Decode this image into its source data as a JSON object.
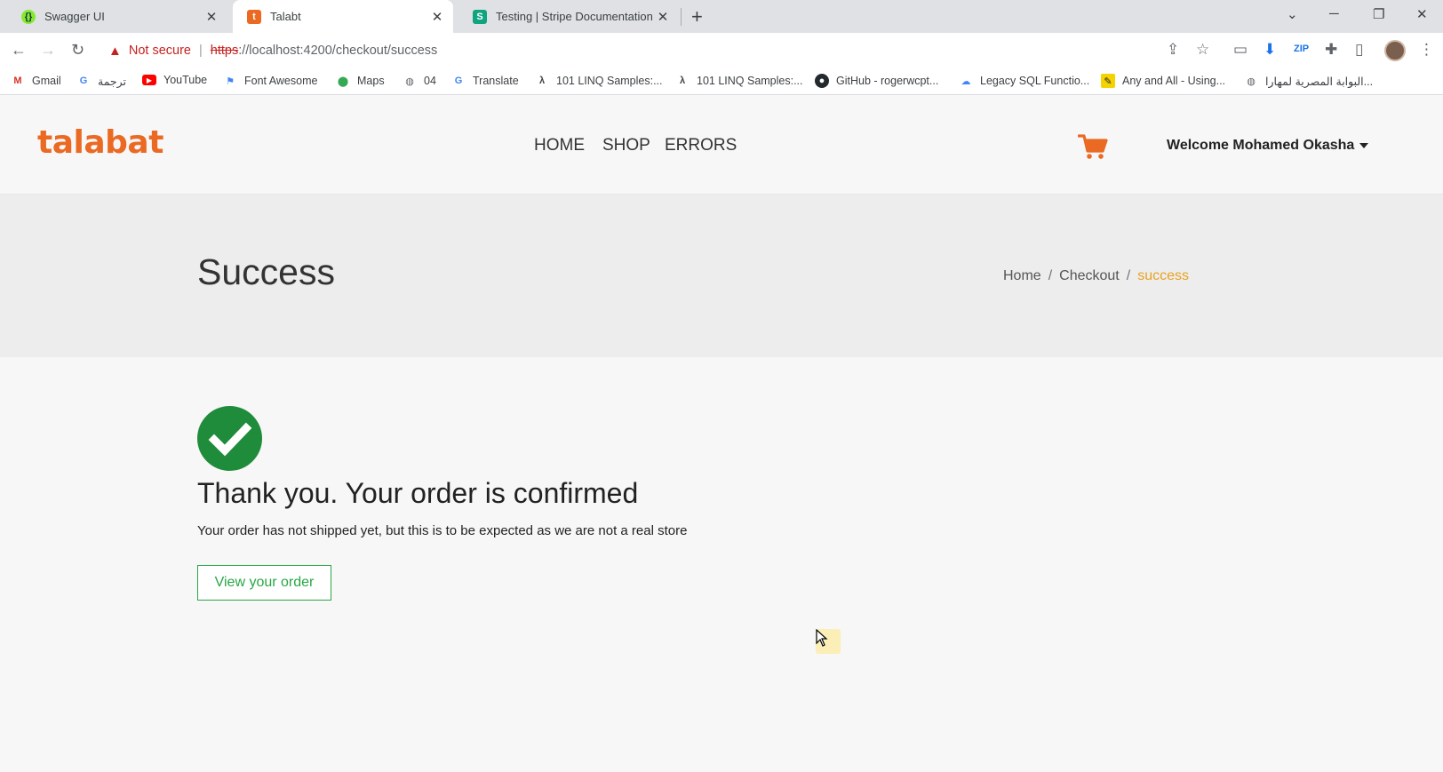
{
  "browser": {
    "tabs": [
      {
        "title": "Swagger UI",
        "favicon": "swagger-icon",
        "favicon_color": "#85ea2d",
        "active": false
      },
      {
        "title": "Talabt",
        "favicon": "talabat-icon",
        "favicon_color": "#ea6a24",
        "active": true
      },
      {
        "title": "Testing | Stripe Documentation",
        "favicon": "stripe-icon",
        "favicon_color": "#10a37f",
        "active": false
      }
    ],
    "address": {
      "warning": "Not secure",
      "scheme": "https",
      "rest": "://localhost:4200/checkout/success"
    },
    "bookmarks": [
      {
        "label": "Gmail",
        "icon": "gmail-icon"
      },
      {
        "label": "ترجمة",
        "icon": "translate-icon"
      },
      {
        "label": "YouTube",
        "icon": "youtube-icon"
      },
      {
        "label": "Font Awesome",
        "icon": "flag-icon"
      },
      {
        "label": "Maps",
        "icon": "maps-icon"
      },
      {
        "label": "04",
        "icon": "globe-icon"
      },
      {
        "label": "Translate",
        "icon": "translate-icon"
      },
      {
        "label": "101 LINQ Samples:...",
        "icon": "linq-icon"
      },
      {
        "label": "101 LINQ Samples:...",
        "icon": "linq-icon"
      },
      {
        "label": "GitHub - rogerwcpt...",
        "icon": "github-icon"
      },
      {
        "label": "Legacy SQL Functio...",
        "icon": "cloud-icon"
      },
      {
        "label": "Any and All - Using...",
        "icon": "pencil-icon"
      },
      {
        "label": "البوابة المصرية لمهارا...",
        "icon": "globe-icon"
      }
    ]
  },
  "site": {
    "logo": "talabat",
    "nav": [
      "HOME",
      "SHOP",
      "ERRORS"
    ],
    "welcome": "Welcome Mohamed Okasha",
    "accent": "#ea6a24"
  },
  "page": {
    "title": "Success",
    "breadcrumb": {
      "home": "Home",
      "checkout": "Checkout",
      "current": "success"
    }
  },
  "confirmation": {
    "heading": "Thank you. Your order is confirmed",
    "message": "Your order has not shipped yet, but this is to be expected as we are not a real store",
    "button": "View your order",
    "check_color": "#1f8c3b"
  }
}
